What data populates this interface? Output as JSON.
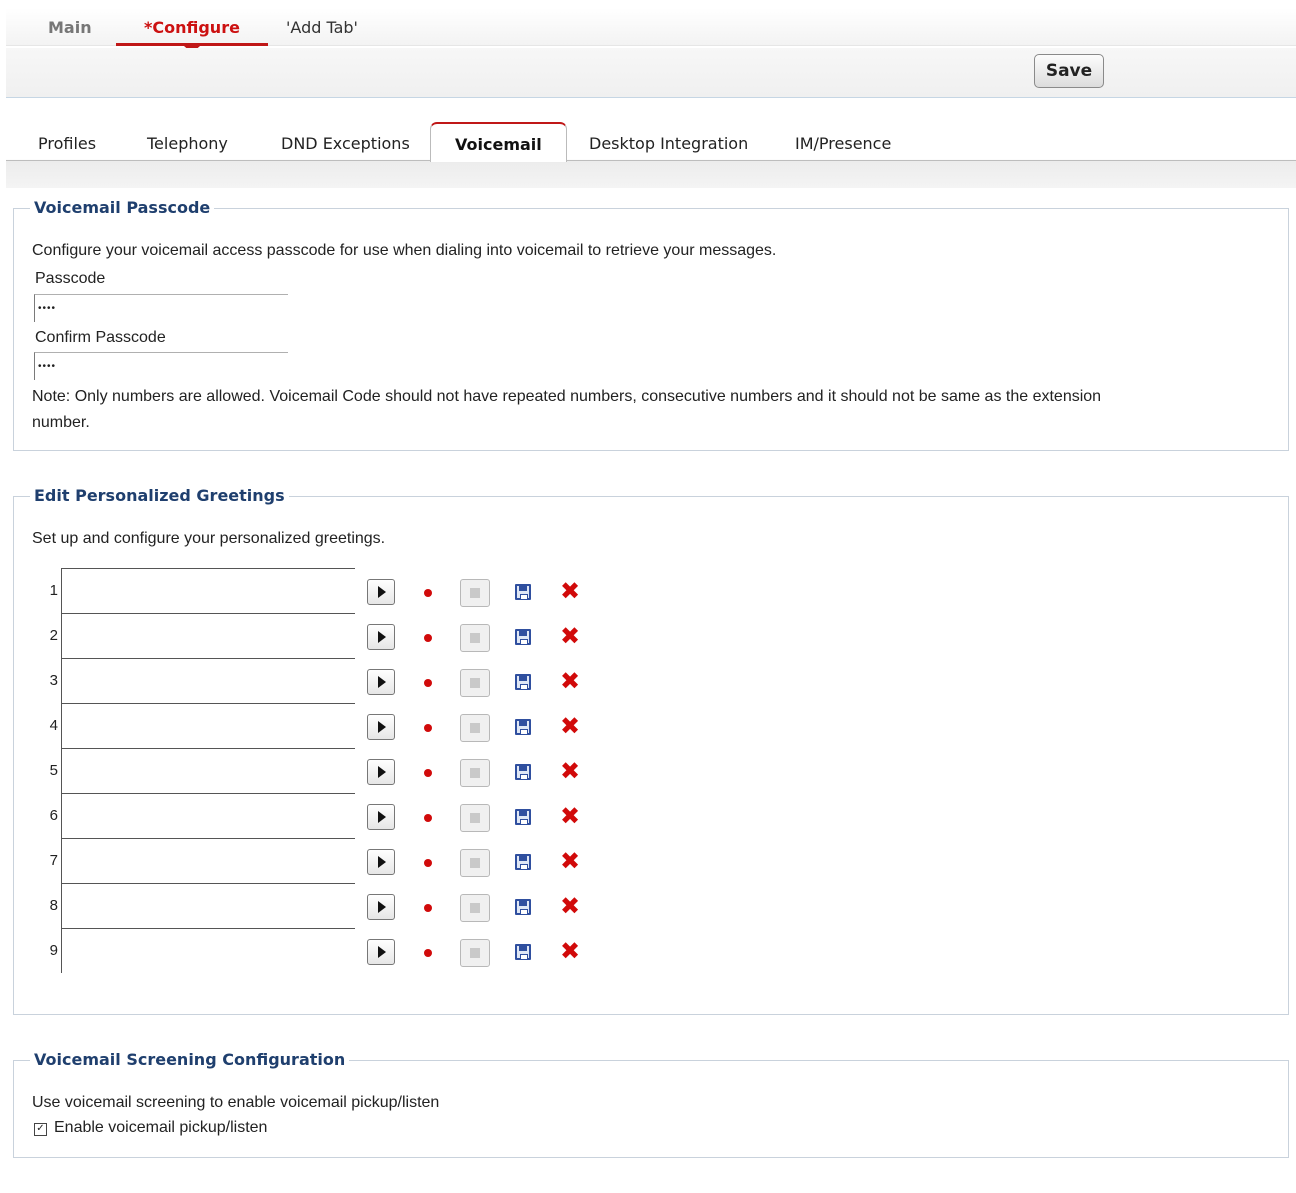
{
  "top_tabs": {
    "main": "Main",
    "configure": "*Configure",
    "add_tab": "'Add Tab'"
  },
  "toolbar": {
    "save_label": "Save"
  },
  "sub_tabs": {
    "profiles": "Profiles",
    "telephony": "Telephony",
    "dnd": "DND Exceptions",
    "voicemail": "Voicemail",
    "desktop": "Desktop Integration",
    "im": "IM/Presence"
  },
  "passcode_section": {
    "legend": "Voicemail Passcode",
    "description": "Configure your voicemail access passcode for use when dialing into voicemail to retrieve your messages.",
    "passcode_label": "Passcode",
    "passcode_value": "••••",
    "confirm_label": "Confirm Passcode",
    "confirm_value": "••••",
    "note_line1": "Note: Only numbers are allowed. Voicemail Code should not have repeated numbers, consecutive numbers and it should not be same as the extension",
    "note_line2": "number."
  },
  "greetings_section": {
    "legend": "Edit Personalized Greetings",
    "description": "Set up and configure your personalized greetings.",
    "rows": [
      {
        "num": "1",
        "value": ""
      },
      {
        "num": "2",
        "value": ""
      },
      {
        "num": "3",
        "value": ""
      },
      {
        "num": "4",
        "value": ""
      },
      {
        "num": "5",
        "value": ""
      },
      {
        "num": "6",
        "value": ""
      },
      {
        "num": "7",
        "value": ""
      },
      {
        "num": "8",
        "value": ""
      },
      {
        "num": "9",
        "value": ""
      }
    ],
    "delete_glyph": "✖"
  },
  "screening_section": {
    "legend": "Voicemail Screening Configuration",
    "description": "Use voicemail screening to enable voicemail pickup/listen",
    "checkbox_label": "Enable voicemail pickup/listen",
    "checkbox_checked": true,
    "check_glyph": "✓"
  },
  "colors": {
    "accent_red": "#c01818",
    "legend_blue": "#1f3f6e",
    "border": "#c9d2dc"
  }
}
